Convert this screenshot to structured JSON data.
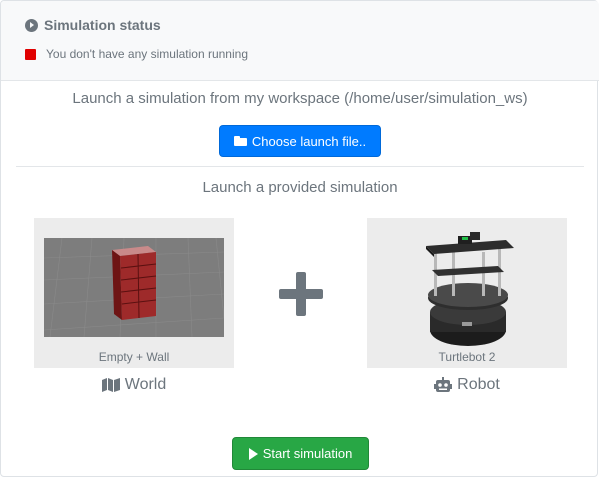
{
  "status": {
    "title": "Simulation status",
    "message": "You don't have any simulation running",
    "indicator_color": "#e00000"
  },
  "workspace": {
    "title": "Launch a simulation from my workspace (/home/user/simulation_ws)",
    "choose_button": "Choose launch file..",
    "button_icon": "folder-icon"
  },
  "provided": {
    "title": "Launch a provided simulation",
    "world": {
      "caption": "Empty + Wall",
      "label": "World",
      "icon": "map-icon"
    },
    "robot": {
      "caption": "Turtlebot 2",
      "label": "Robot",
      "icon": "robot-icon"
    },
    "combine_icon": "plus-icon"
  },
  "actions": {
    "start_button": "Start simulation",
    "button_icon": "play-icon"
  },
  "colors": {
    "primary": "#007bff",
    "success": "#28a745",
    "muted_text": "#6c757d"
  }
}
